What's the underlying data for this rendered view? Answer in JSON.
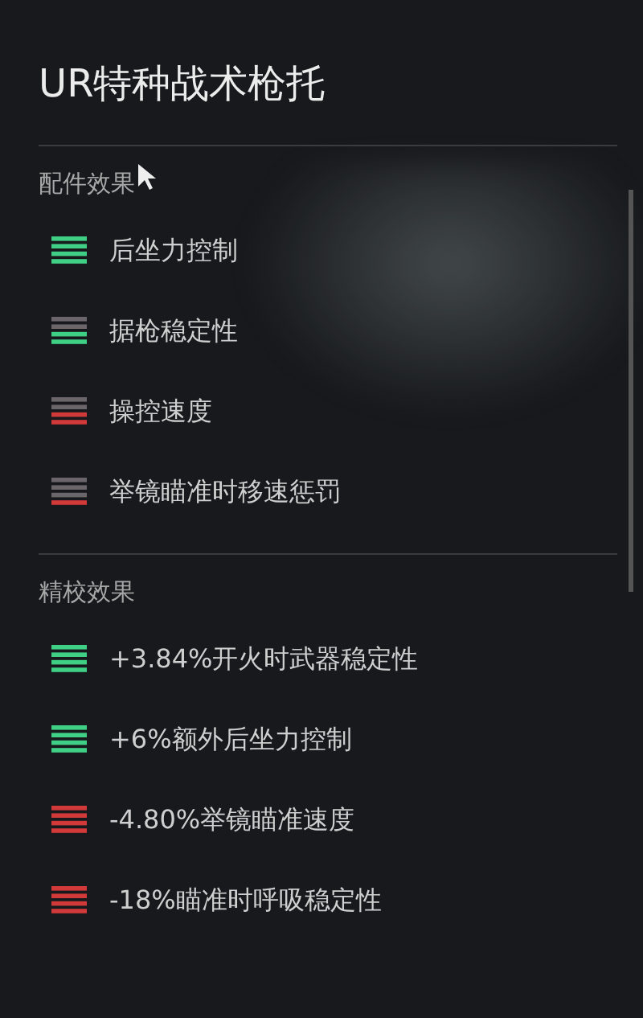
{
  "title": "UR特种战术枪托",
  "sections": [
    {
      "heading": "配件效果",
      "items": [
        {
          "label": "后坐力控制",
          "kind": "positive",
          "bars": [
            {
              "on": true
            },
            {
              "on": true
            },
            {
              "on": true
            },
            {
              "on": true
            }
          ]
        },
        {
          "label": "据枪稳定性",
          "kind": "positive",
          "bars": [
            {
              "on": false
            },
            {
              "on": false
            },
            {
              "on": true
            },
            {
              "on": true
            }
          ]
        },
        {
          "label": "操控速度",
          "kind": "negative",
          "bars": [
            {
              "on": false
            },
            {
              "on": false
            },
            {
              "on": true
            },
            {
              "on": true
            }
          ]
        },
        {
          "label": "举镜瞄准时移速惩罚",
          "kind": "negative",
          "bars": [
            {
              "on": false
            },
            {
              "on": false
            },
            {
              "on": false
            },
            {
              "on": true
            }
          ]
        }
      ]
    },
    {
      "heading": "精校效果",
      "items": [
        {
          "label": "+3.84%开火时武器稳定性",
          "kind": "positive",
          "bars": [
            {
              "on": true
            },
            {
              "on": true
            },
            {
              "on": true
            },
            {
              "on": true
            }
          ]
        },
        {
          "label": "+6%额外后坐力控制",
          "kind": "positive",
          "bars": [
            {
              "on": true
            },
            {
              "on": true
            },
            {
              "on": true
            },
            {
              "on": true
            }
          ]
        },
        {
          "label": "-4.80%举镜瞄准速度",
          "kind": "negative",
          "bars": [
            {
              "on": true
            },
            {
              "on": true
            },
            {
              "on": true
            },
            {
              "on": true
            }
          ]
        },
        {
          "label": "-18%瞄准时呼吸稳定性",
          "kind": "negative",
          "bars": [
            {
              "on": true
            },
            {
              "on": true
            },
            {
              "on": true
            },
            {
              "on": true
            }
          ]
        }
      ]
    }
  ]
}
